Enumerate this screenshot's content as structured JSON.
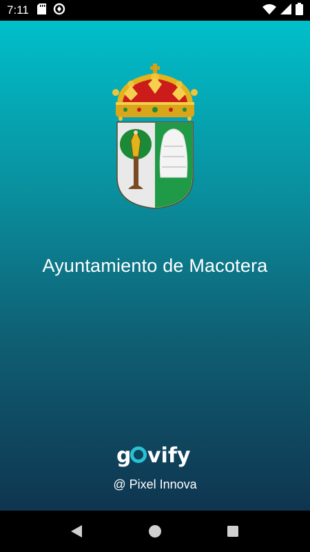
{
  "status_bar": {
    "time": "7:11",
    "left_icons": [
      "sd-card-icon",
      "data-saver-icon"
    ],
    "right_icons": [
      "wifi-icon",
      "cell-signal-icon",
      "battery-icon"
    ]
  },
  "splash": {
    "app_title": "Ayuntamiento de Macotera",
    "brand_name": "govify",
    "credit": "@ Pixel Innova",
    "colors": {
      "gradient_top": "#00bfca",
      "gradient_bottom": "#0f3550",
      "brand_accent": "#27c2d3"
    }
  },
  "nav_bar": {
    "buttons": [
      "back-icon",
      "home-icon",
      "recents-icon"
    ]
  }
}
